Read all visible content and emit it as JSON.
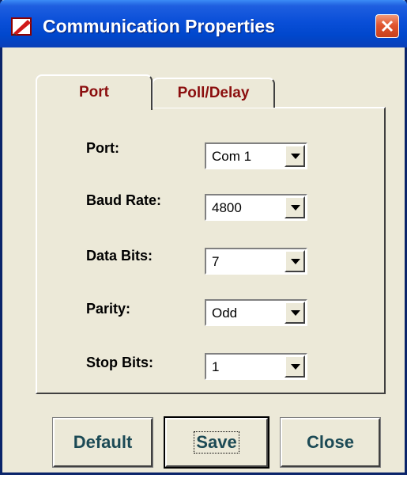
{
  "window": {
    "title": "Communication Properties"
  },
  "tabs": [
    {
      "label": "Port",
      "selected": true
    },
    {
      "label": "Poll/Delay",
      "selected": false
    }
  ],
  "fields": [
    {
      "label": "Port:",
      "value": "Com 1"
    },
    {
      "label": "Baud Rate:",
      "value": "4800"
    },
    {
      "label": "Data Bits:",
      "value": "7"
    },
    {
      "label": "Parity:",
      "value": "Odd"
    },
    {
      "label": "Stop Bits:",
      "value": "1"
    }
  ],
  "buttons": {
    "default_label": "Default",
    "save_label": "Save",
    "close_label": "Close"
  },
  "colors": {
    "titlebar": "#0047cc",
    "tab_text": "#8b0e0e",
    "button_text": "#1c4a55",
    "dialog_face": "#ece9d8"
  },
  "icons": {
    "app": "app-icon",
    "close": "close-icon",
    "dropdown": "chevron-down-icon"
  }
}
